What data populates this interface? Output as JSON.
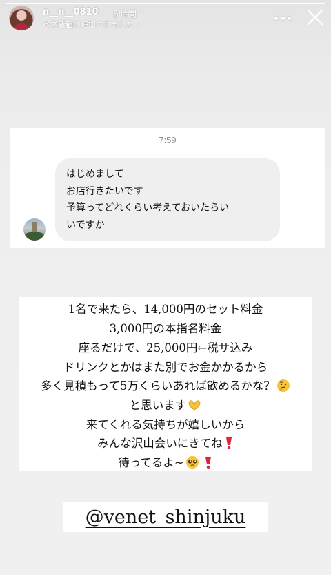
{
  "story": {
    "progress": 1.0,
    "username": "n__n__0810",
    "time_ago": "5時間",
    "added_to_highlight": {
      "highlight_name": "ベネ新宿",
      "suffix": "に追加されました",
      "chevron": "›"
    },
    "icons": {
      "more": "more-horizontal-icon",
      "close": "close-icon"
    }
  },
  "dm": {
    "timestamp": "7:59",
    "lines": [
      "はじめまして",
      "お店行きたいです",
      "予算ってどれくらい考えておいたらい",
      "いですか"
    ]
  },
  "caption": {
    "lines": [
      {
        "text": "1名で来たら、14,000円のセット料金",
        "emoji": ""
      },
      {
        "text": "3,000円の本指名料金",
        "emoji": ""
      },
      {
        "text": "座るだけで、25,000円←税サ込み",
        "emoji": ""
      },
      {
        "text": "ドリンクとかはまた別でお金かかるから",
        "emoji": ""
      },
      {
        "text": "多く見積もって5万くらいあれば飲めるかな？",
        "emoji": "thinking-face"
      },
      {
        "text": "と思います",
        "emoji": "heart-hands"
      },
      {
        "text": "来てくれる気持ちが嬉しいから",
        "emoji": ""
      },
      {
        "text": "みんな沢山会いにきてね",
        "emoji": "heavy-exclamation"
      },
      {
        "text": "待ってるよ~",
        "emoji": "pleading-face+heavy-exclamation"
      }
    ]
  },
  "mention": {
    "handle": "@venet_shinjuku"
  },
  "colors": {
    "background": "#efefef",
    "bubble": "#efefef",
    "timestamp": "#8e8e8e",
    "exclamation_red": "#e0243a",
    "emoji_yellow": "#f7c43a"
  }
}
